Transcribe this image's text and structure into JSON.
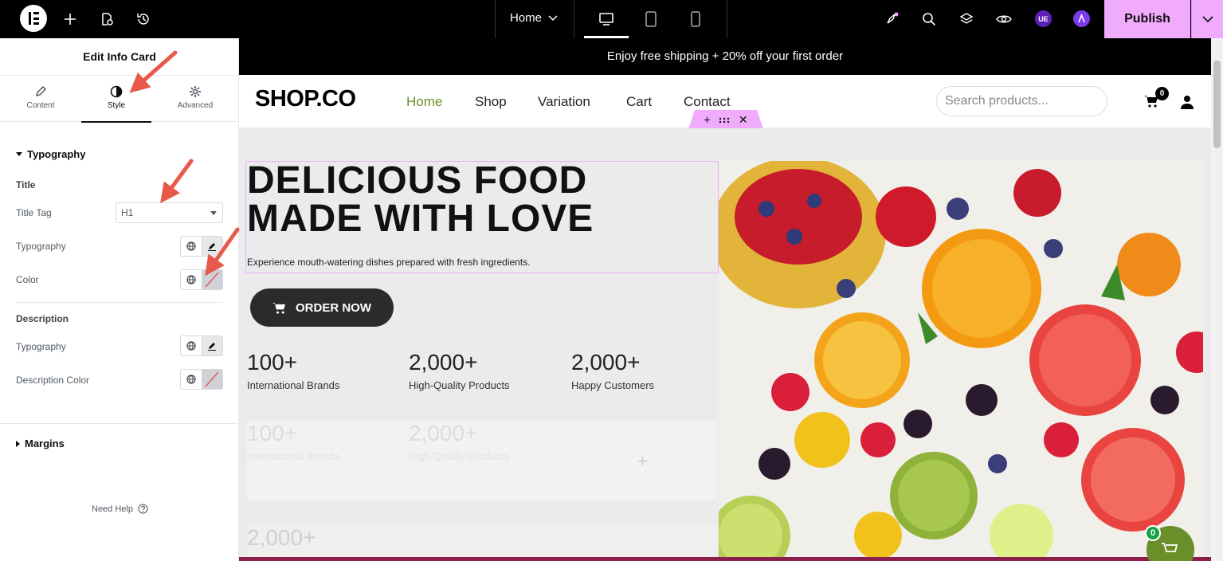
{
  "topbar": {
    "page_name": "Home",
    "publish_label": "Publish",
    "avatar_ue": "UE",
    "accent": "#f0abfc"
  },
  "panel": {
    "title": "Edit Info Card",
    "tabs": [
      {
        "label": "Content",
        "icon": "pencil-icon"
      },
      {
        "label": "Style",
        "icon": "half-circle-icon"
      },
      {
        "label": "Advanced",
        "icon": "gear-icon"
      }
    ],
    "typography_section": "Typography",
    "title_group": "Title",
    "title_tag_label": "Title Tag",
    "title_tag_value": "H1",
    "title_typography_label": "Typography",
    "title_color_label": "Color",
    "description_group": "Description",
    "desc_typography_label": "Typography",
    "desc_color_label": "Description Color",
    "margins_section": "Margins",
    "need_help": "Need Help"
  },
  "site": {
    "announcement": "Enjoy free shipping + 20% off your first order",
    "logo": "SHOP.CO",
    "nav": [
      "Home",
      "Shop",
      "Variation",
      "Cart",
      "Contact"
    ],
    "search_placeholder": "Search products...",
    "cart_count": "0",
    "hero_title_line1": "DELICIOUS FOOD",
    "hero_title_line2": "MADE WITH LOVE",
    "hero_description": "Experience mouth-watering dishes prepared with fresh ingredients.",
    "order_button": "ORDER NOW",
    "stats": [
      {
        "value": "100+",
        "label": "International Brands"
      },
      {
        "value": "2,000+",
        "label": "High-Quality Products"
      },
      {
        "value": "2,000+",
        "label": "Happy Customers"
      }
    ],
    "ghost_stats": [
      {
        "value": "100+",
        "label": "International Brands"
      },
      {
        "value": "2,000+",
        "label": "High-Quality Products"
      },
      {
        "value": "2,000+",
        "label": ""
      }
    ],
    "floating_cart_count": "0",
    "active_nav_color": "#6a8f2a"
  }
}
